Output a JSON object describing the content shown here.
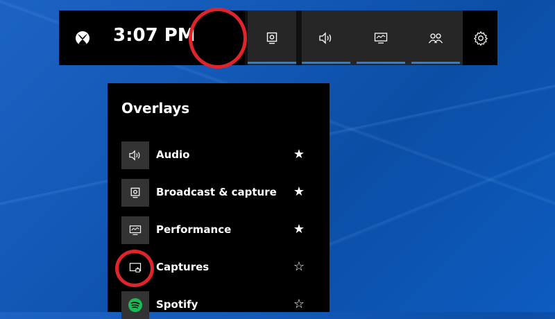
{
  "topbar": {
    "clock": "3:07 PM",
    "widgets": [
      {
        "name": "broadcast-capture",
        "icon": "webcam-icon"
      },
      {
        "name": "audio",
        "icon": "speaker-icon"
      },
      {
        "name": "performance",
        "icon": "monitor-graph-icon"
      },
      {
        "name": "social",
        "icon": "people-icon"
      }
    ]
  },
  "overlays": {
    "title": "Overlays",
    "items": [
      {
        "label": "Audio",
        "icon": "speaker-icon",
        "star": "★"
      },
      {
        "label": "Broadcast & capture",
        "icon": "webcam-icon",
        "star": "★"
      },
      {
        "label": "Performance",
        "icon": "monitor-graph-icon",
        "star": "★"
      },
      {
        "label": "Captures",
        "icon": "gallery-icon",
        "star": "☆"
      },
      {
        "label": "Spotify",
        "icon": "spotify-icon",
        "star": "☆"
      }
    ]
  },
  "colors": {
    "highlight_ring": "#e0242b",
    "accent": "#2a80d6",
    "spotify": "#1db954"
  }
}
